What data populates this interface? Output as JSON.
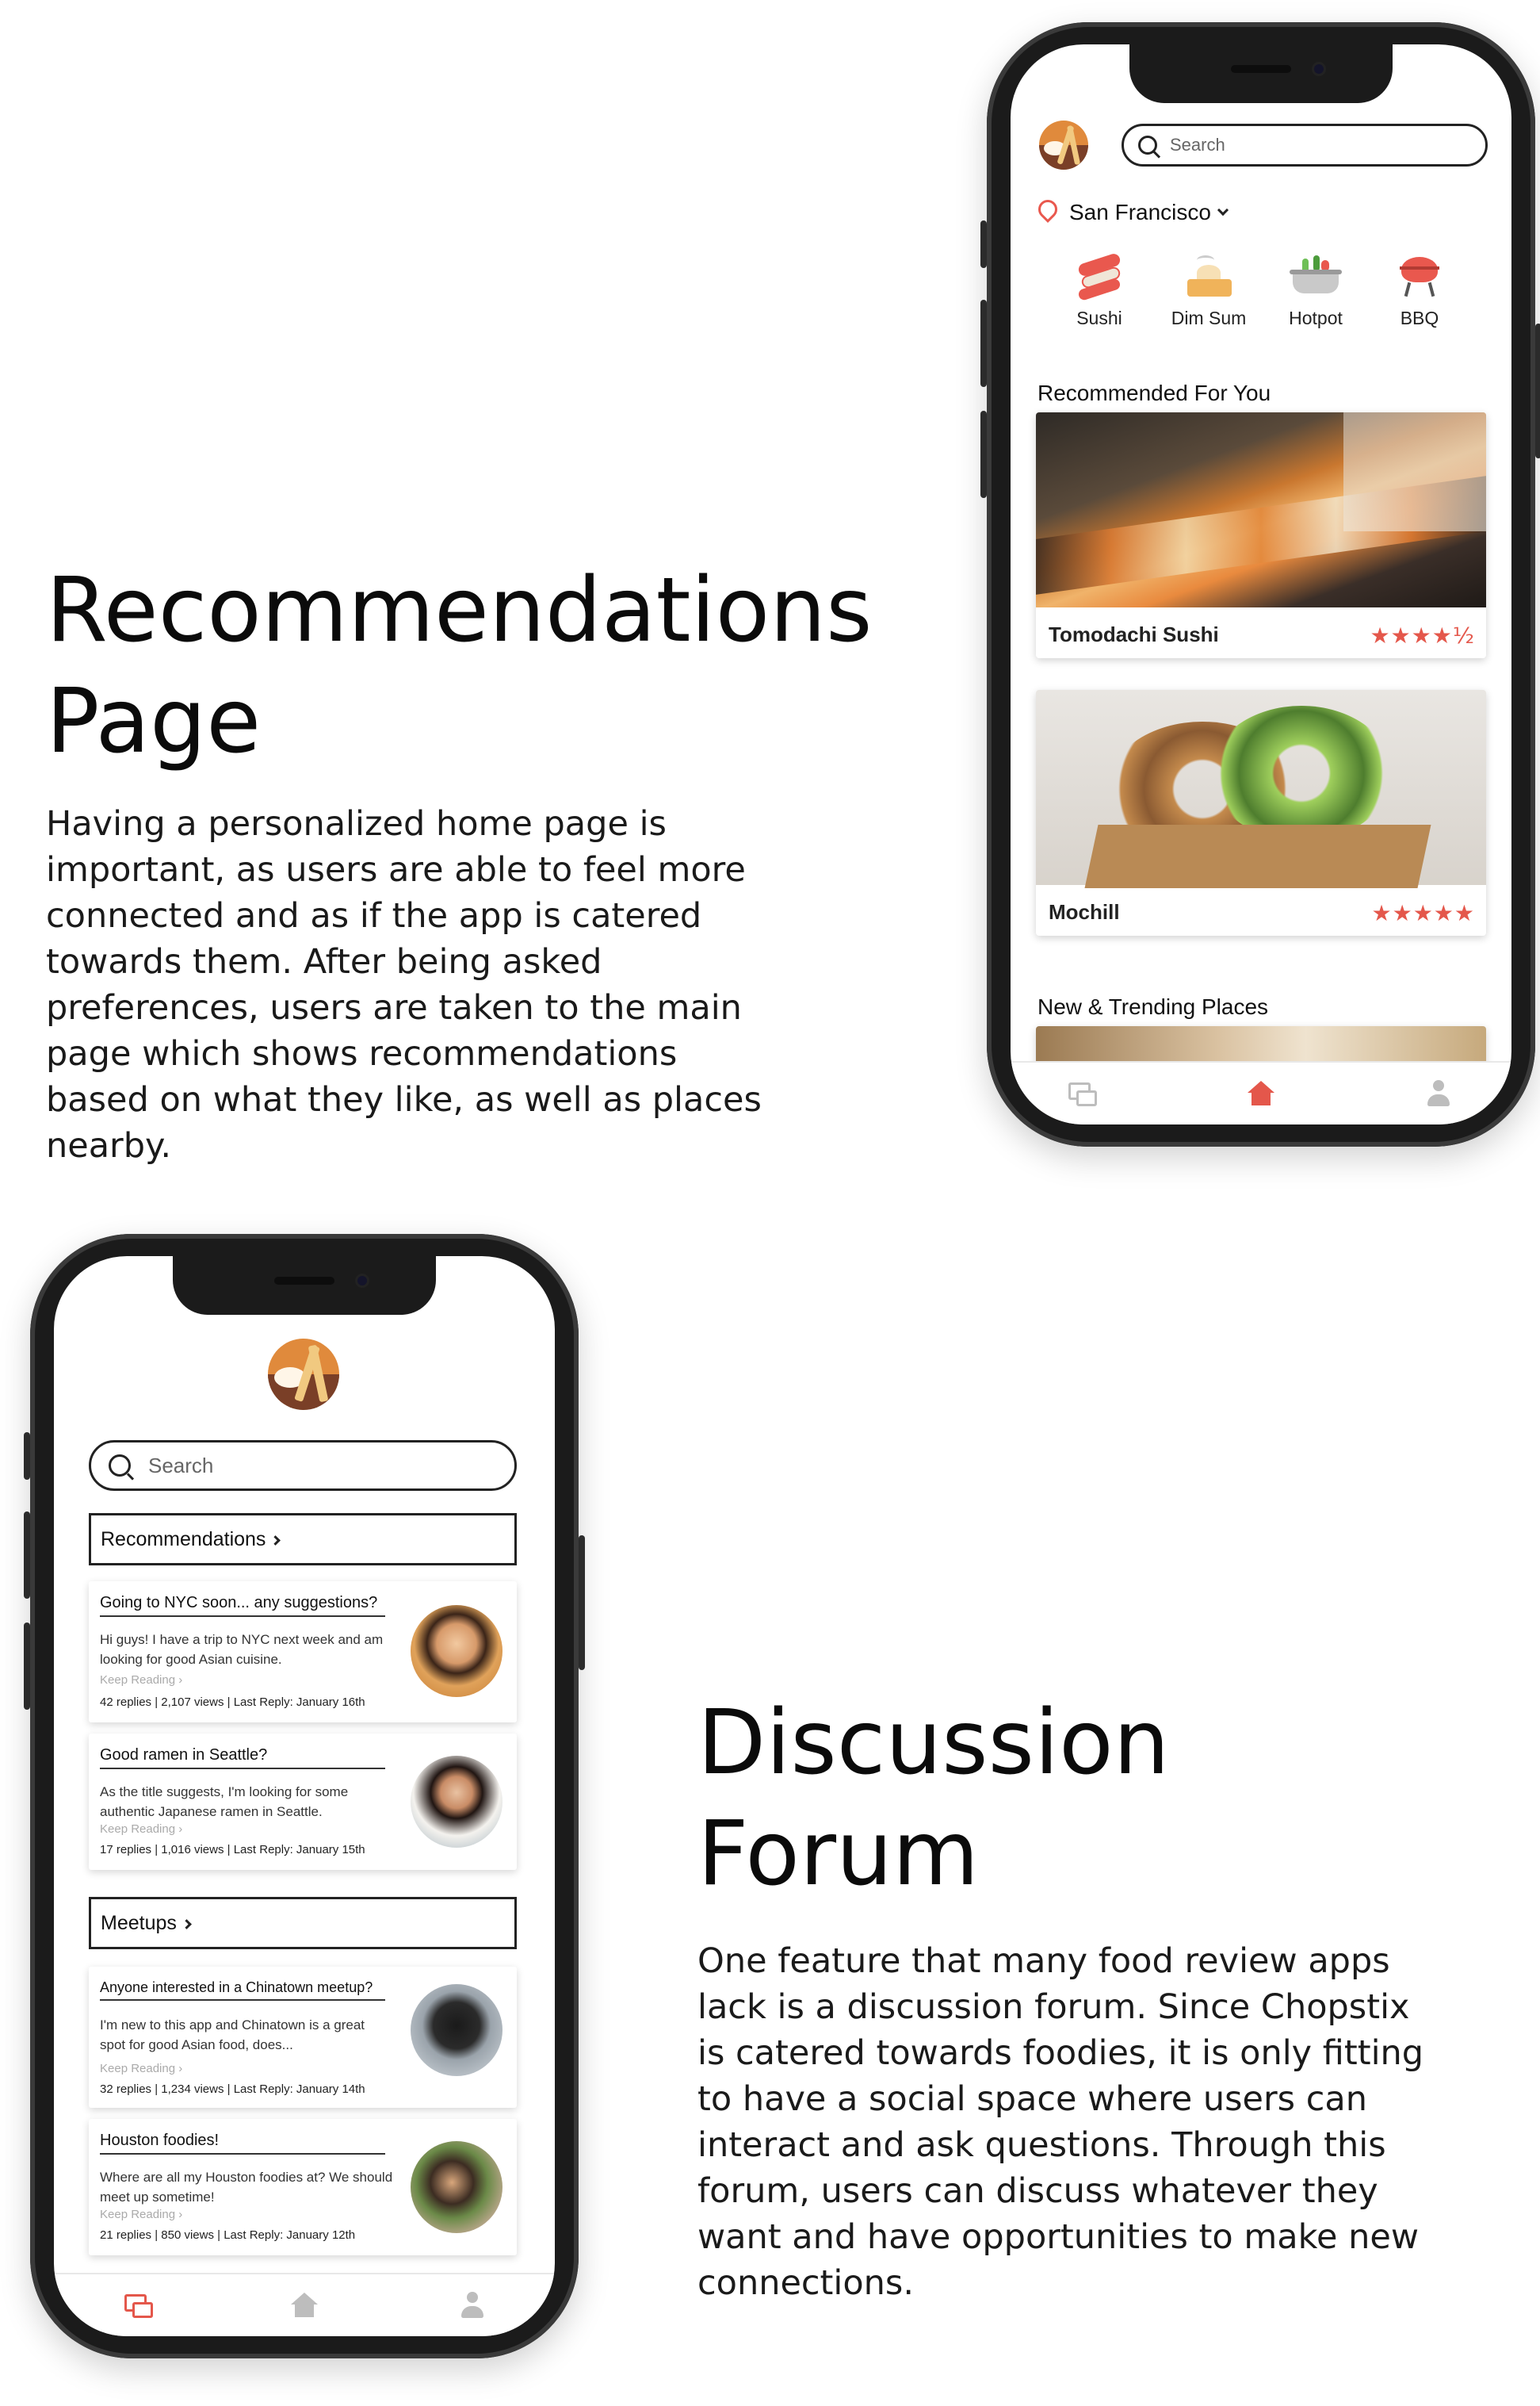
{
  "recommendations_section": {
    "heading_line1": "Recommendations",
    "heading_line2": "Page",
    "paragraph": "Having a personalized home page is important, as users are able to feel more connected and as if the app is catered towards them. After being asked preferences, users are taken to the main page which shows recommendations based on what they like, as well as places nearby."
  },
  "forum_section": {
    "heading_line1": "Discussion",
    "heading_line2": "Forum",
    "paragraph": "One feature that many food review apps lack is a discussion forum. Since Chopstix is catered towards foodies, it is only fitting to have a social space where users can interact and ask questions. Through this forum, users can discuss whatever they want and have opportunities to make new connections."
  },
  "home_screen": {
    "search_placeholder": "Search",
    "location": "San Francisco",
    "categories": [
      {
        "label": "Sushi",
        "icon": "sushi-icon"
      },
      {
        "label": "Dim Sum",
        "icon": "dim-sum-icon"
      },
      {
        "label": "Hotpot",
        "icon": "hotpot-icon"
      },
      {
        "label": "BBQ",
        "icon": "bbq-icon"
      }
    ],
    "recommended_title": "Recommended For You",
    "restaurants": [
      {
        "name": "Tomodachi Sushi",
        "stars": "★★★★½",
        "rating": 4.5
      },
      {
        "name": "Mochill",
        "stars": "★★★★★",
        "rating": 5
      }
    ],
    "trending_title": "New & Trending Places",
    "active_tab": "home",
    "accent_color": "#e4574b"
  },
  "forum_screen": {
    "search_placeholder": "Search",
    "recommendations_label": "Recommendations",
    "meetups_label": "Meetups",
    "recommendation_posts": [
      {
        "title": "Going to NYC soon... any suggestions?",
        "body": "Hi guys! I have a trip to NYC next week and am looking for good Asian cuisine.",
        "more": "Keep Reading ›",
        "meta": "42 replies | 2,107 views | Last Reply: January 16th"
      },
      {
        "title": "Good ramen in Seattle?",
        "body": "As the title suggests, I'm looking for some authentic Japanese ramen in Seattle.",
        "more": "Keep Reading ›",
        "meta": "17 replies | 1,016 views | Last Reply: January 15th"
      }
    ],
    "meetup_posts": [
      {
        "title": "Anyone interested in a Chinatown meetup?",
        "body": "I'm new to this app and Chinatown is a great spot for good Asian food, does...",
        "more": "Keep Reading ›",
        "meta": "32 replies | 1,234 views | Last Reply: January 14th"
      },
      {
        "title": "Houston foodies!",
        "body": "Where are all my Houston foodies at? We should meet up sometime!",
        "more": "Keep Reading ›",
        "meta": "21 replies | 850 views | Last Reply: January 12th"
      }
    ],
    "active_tab": "forum"
  }
}
